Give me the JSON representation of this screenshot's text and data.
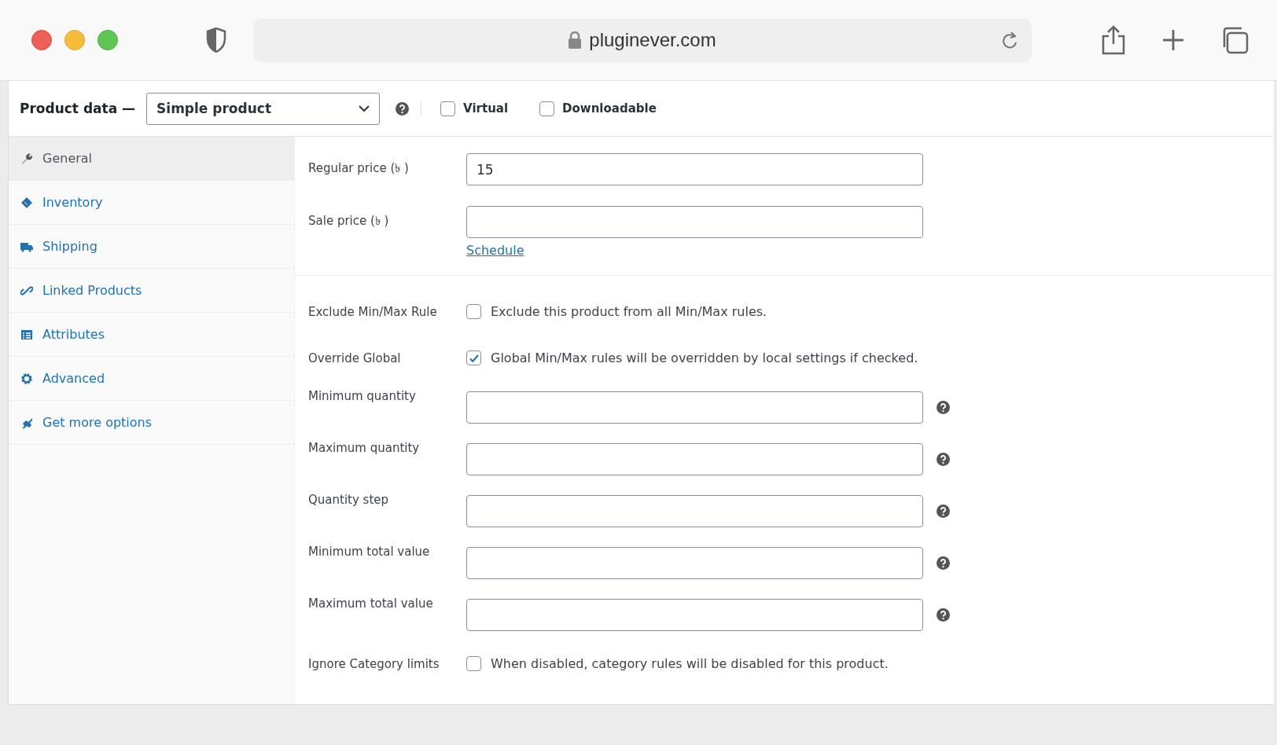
{
  "browser": {
    "url": "pluginever.com"
  },
  "product_data": {
    "title": "Product data —",
    "product_type": "Simple product",
    "options": [
      {
        "label": "Virtual",
        "checked": false
      },
      {
        "label": "Downloadable",
        "checked": false
      }
    ]
  },
  "tabs": [
    {
      "label": "General",
      "selected": true
    },
    {
      "label": "Inventory",
      "selected": false
    },
    {
      "label": "Shipping",
      "selected": false
    },
    {
      "label": "Linked Products",
      "selected": false
    },
    {
      "label": "Attributes",
      "selected": false
    },
    {
      "label": "Advanced",
      "selected": false
    },
    {
      "label": "Get more options",
      "selected": false
    }
  ],
  "price_fields": [
    {
      "label": "Regular price (৳ )",
      "value": "15"
    },
    {
      "label": "Sale price (৳ )"
    }
  ],
  "schedule_link": "Schedule",
  "minmax_fields": [
    {
      "kind": "checkbox",
      "label": "Exclude Min/Max Rule",
      "description": "Exclude this product from all Min/Max rules.",
      "checked": false
    },
    {
      "kind": "checkbox",
      "label": "Override Global",
      "description": "Global Min/Max rules will be overridden by local settings if checked.",
      "checked": true
    },
    {
      "kind": "text",
      "label": "Minimum quantity"
    },
    {
      "kind": "text",
      "label": "Maximum quantity"
    },
    {
      "kind": "text",
      "label": "Quantity step"
    },
    {
      "kind": "text",
      "label": "Minimum total value"
    },
    {
      "kind": "text",
      "label": "Maximum total value"
    },
    {
      "kind": "checkbox",
      "label": "Ignore Category limits",
      "description": "When disabled, category rules will be disabled for this product.",
      "checked": false
    }
  ]
}
